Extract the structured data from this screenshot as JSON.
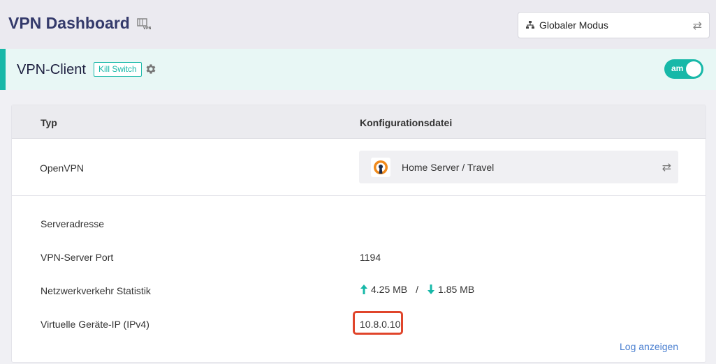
{
  "header": {
    "title": "VPN Dashboard",
    "title_icon": "vpn-icon",
    "mode_select": {
      "value": "Globaler Modus",
      "icon": "network-icon"
    }
  },
  "client": {
    "title": "VPN-Client",
    "kill_switch": "Kill Switch",
    "toggle_label": "am",
    "accent_color": "#17b8a8"
  },
  "table": {
    "col_type": "Typ",
    "col_config": "Konfigurationsdatei",
    "row": {
      "type": "OpenVPN",
      "config": "Home Server / Travel"
    }
  },
  "details": {
    "server_address_label": "Serveradresse",
    "server_address_value": "",
    "port_label": "VPN-Server Port",
    "port_value": "1194",
    "traffic_label": "Netzwerkverkehr Statistik",
    "upload": "4.25 MB",
    "separator": "/",
    "download": "1.85 MB",
    "ip_label": "Virtuelle Geräte-IP (IPv4)",
    "ip_value": "10.8.0.10",
    "highlight_color": "#e0452b",
    "log_link": "Log anzeigen"
  }
}
